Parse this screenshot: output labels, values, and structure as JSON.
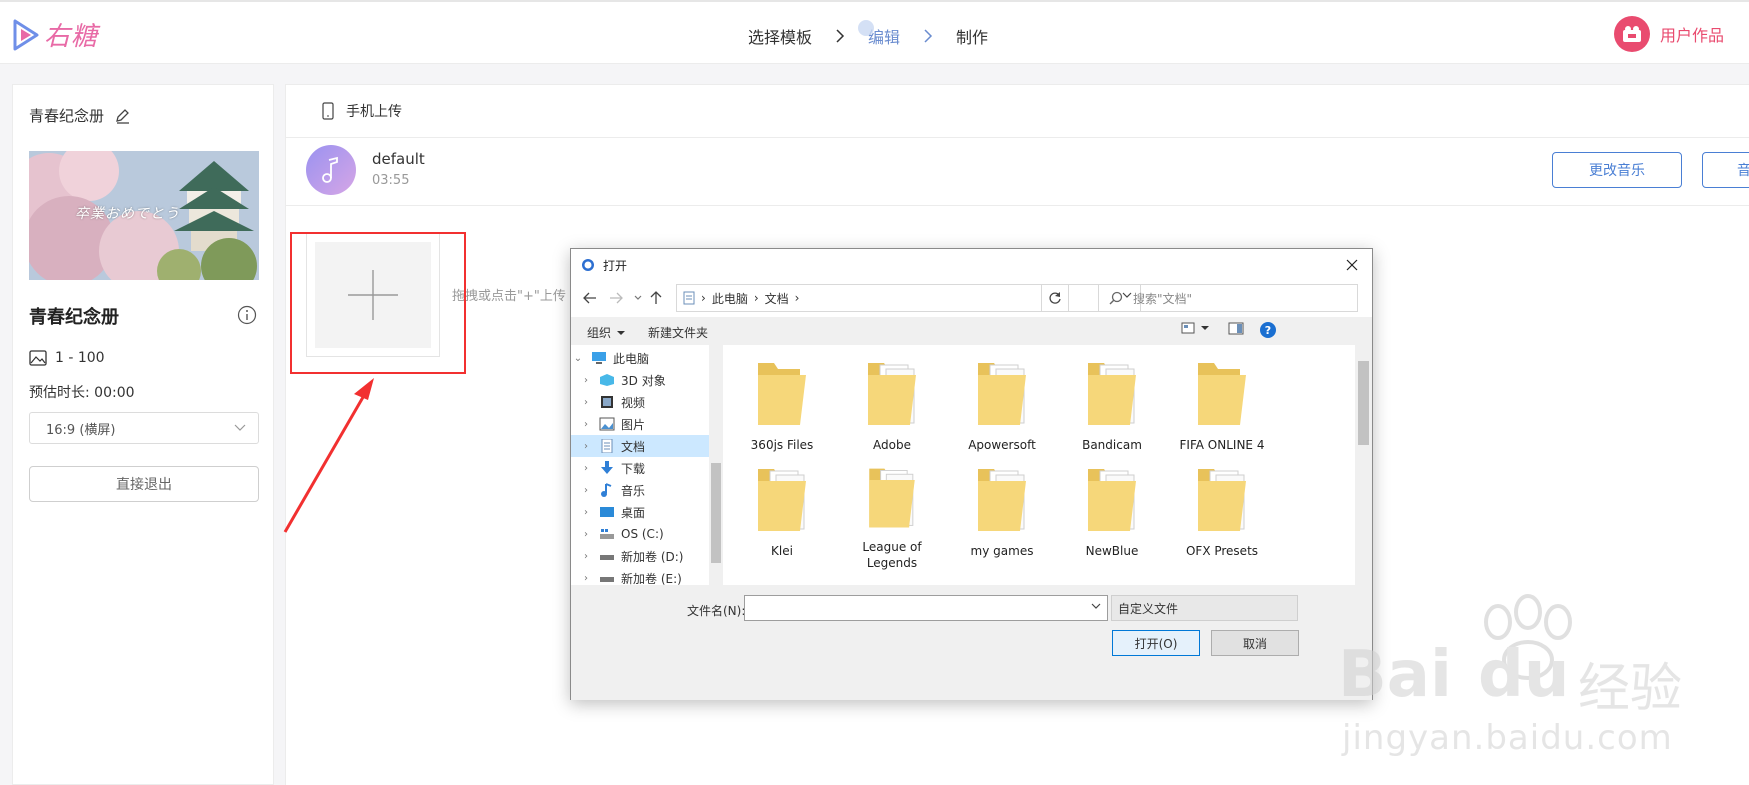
{
  "header": {
    "logo_text": "右糖",
    "steps": [
      "选择模板",
      "编辑",
      "制作"
    ],
    "user_works_label": "用户作品"
  },
  "left_panel": {
    "title": "青春纪念册",
    "cover_caption": "卒業おめでとう",
    "album_name": "青春纪念册",
    "photo_range": "1 - 100",
    "estimated_duration": "预估时长: 00:00",
    "aspect_ratio": "16:9 (横屏)",
    "exit_button": "直接退出"
  },
  "main_panel": {
    "mobile_upload": "手机上传",
    "music": {
      "name": "default",
      "duration": "03:55"
    },
    "change_music_button": "更改音乐",
    "second_music_button": "音",
    "drag_hint": "拖拽或点击\"+\"上传"
  },
  "dialog": {
    "title": "打开",
    "breadcrumb": [
      "此电脑",
      "文档"
    ],
    "search_placeholder": "搜索\"文档\"",
    "toolbar": {
      "organize": "组织",
      "new_folder": "新建文件夹"
    },
    "tree": [
      {
        "label": "此电脑",
        "icon": "pc-icon"
      },
      {
        "label": "3D 对象",
        "icon": "3d-objects-icon"
      },
      {
        "label": "视频",
        "icon": "video-icon"
      },
      {
        "label": "图片",
        "icon": "pictures-icon"
      },
      {
        "label": "文档",
        "icon": "documents-icon"
      },
      {
        "label": "下载",
        "icon": "download-icon"
      },
      {
        "label": "音乐",
        "icon": "music-icon"
      },
      {
        "label": "桌面",
        "icon": "desktop-icon"
      },
      {
        "label": "OS (C:)",
        "icon": "drive-c-icon"
      },
      {
        "label": "新加卷 (D:)",
        "icon": "drive-icon"
      },
      {
        "label": "新加卷 (E:)",
        "icon": "drive-icon"
      }
    ],
    "files": [
      "360js Files",
      "Adobe",
      "Apowersoft",
      "Bandicam",
      "FIFA ONLINE 4",
      "Klei",
      "League of Legends",
      "my games",
      "NewBlue",
      "OFX Presets"
    ],
    "filename_label": "文件名(N):",
    "filename_value": "",
    "file_type": "自定义文件",
    "open_button": "打开(O)",
    "cancel_button": "取消"
  },
  "watermark": {
    "brand": "Bai",
    "brand2": "du",
    "brand_cn": "经验",
    "url": "jingyan.baidu.com"
  },
  "colors": {
    "accent_blue": "#4a7fd4",
    "accent_pink": "#e94b6f",
    "annotation_red": "#f23030"
  }
}
